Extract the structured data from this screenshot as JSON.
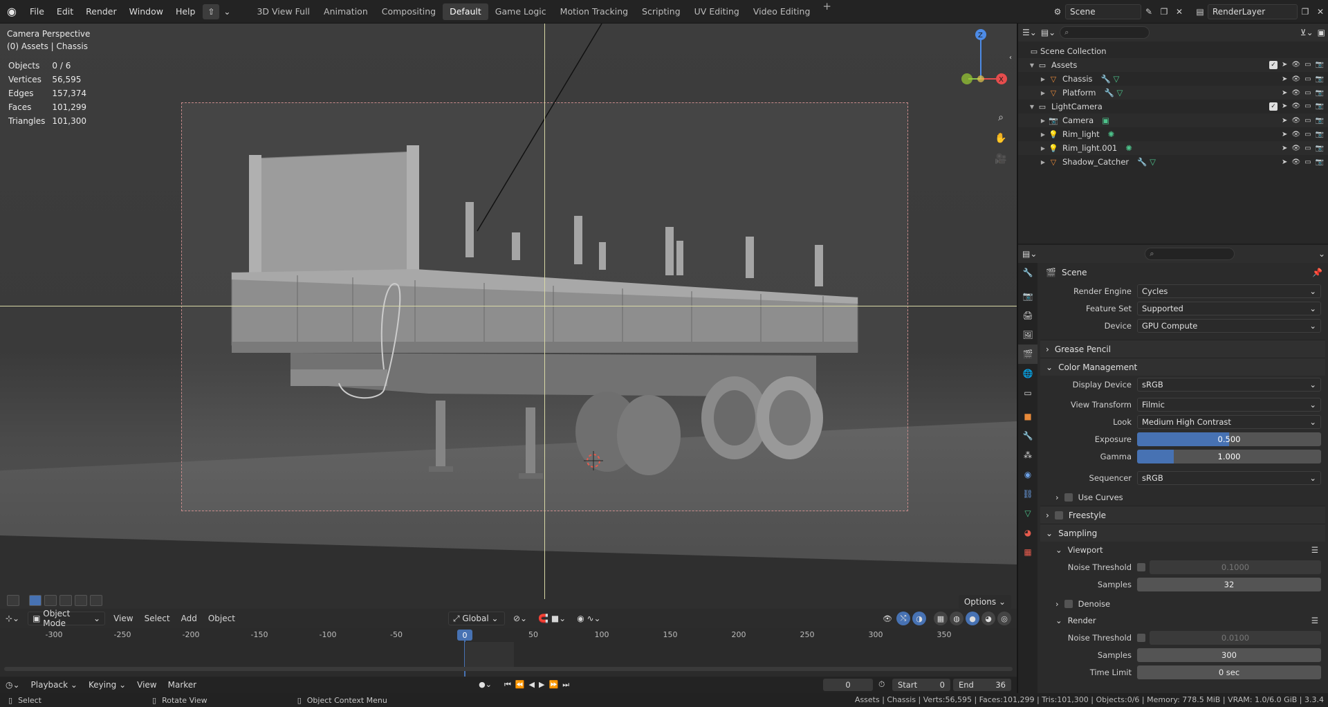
{
  "menu": [
    "File",
    "Edit",
    "Render",
    "Window",
    "Help"
  ],
  "workspaces": [
    "3D View Full",
    "Animation",
    "Compositing",
    "Default",
    "Game Logic",
    "Motion Tracking",
    "Scripting",
    "UV Editing",
    "Video Editing"
  ],
  "active_workspace": "Default",
  "scene_name": "Scene",
  "view_layer": "RenderLayer",
  "viewport": {
    "title": "Camera Perspective",
    "subtitle": "(0) Assets | Chassis",
    "stats": [
      {
        "label": "Objects",
        "value": "0 / 6"
      },
      {
        "label": "Vertices",
        "value": "56,595"
      },
      {
        "label": "Edges",
        "value": "157,374"
      },
      {
        "label": "Faces",
        "value": "101,299"
      },
      {
        "label": "Triangles",
        "value": "101,300"
      }
    ],
    "options_label": "Options"
  },
  "header": {
    "mode": "Object Mode",
    "menus": [
      "View",
      "Select",
      "Add",
      "Object"
    ],
    "transform": "Global"
  },
  "timeline": {
    "ticks": [
      "-300",
      "-250",
      "-200",
      "-150",
      "-100",
      "-50",
      "0",
      "50",
      "100",
      "150",
      "200",
      "250",
      "300",
      "350"
    ],
    "current_frame": "0",
    "menus": [
      "Playback",
      "Keying",
      "View",
      "Marker"
    ],
    "frame_field": "0",
    "start_label": "Start",
    "start": "0",
    "end_label": "End",
    "end": "36"
  },
  "status": {
    "select": "Select",
    "rotate": "Rotate View",
    "context": "Object Context Menu",
    "info": "Assets | Chassis | Verts:56,595 | Faces:101,299 | Tris:101,300 | Objects:0/6 | Memory: 778.5 MiB | VRAM: 1.0/6.0 GiB | 3.3.4"
  },
  "outliner": {
    "root": "Scene Collection",
    "items": [
      {
        "name": "Assets",
        "level": 1,
        "kind": "collection"
      },
      {
        "name": "Chassis",
        "level": 2,
        "kind": "mesh"
      },
      {
        "name": "Platform",
        "level": 2,
        "kind": "mesh"
      },
      {
        "name": "LightCamera",
        "level": 1,
        "kind": "collection"
      },
      {
        "name": "Camera",
        "level": 2,
        "kind": "camera"
      },
      {
        "name": "Rim_light",
        "level": 2,
        "kind": "light"
      },
      {
        "name": "Rim_light.001",
        "level": 2,
        "kind": "light"
      },
      {
        "name": "Shadow_Catcher",
        "level": 2,
        "kind": "mesh"
      }
    ]
  },
  "properties": {
    "context": "Scene",
    "render_engine_label": "Render Engine",
    "render_engine": "Cycles",
    "feature_set_label": "Feature Set",
    "feature_set": "Supported",
    "device_label": "Device",
    "device": "GPU Compute",
    "grease_pencil": "Grease Pencil",
    "color_management": "Color Management",
    "display_device_label": "Display Device",
    "display_device": "sRGB",
    "view_transform_label": "View Transform",
    "view_transform": "Filmic",
    "look_label": "Look",
    "look": "Medium High Contrast",
    "exposure_label": "Exposure",
    "exposure": "0.500",
    "exposure_fill": 0.5,
    "gamma_label": "Gamma",
    "gamma": "1.000",
    "gamma_fill": 0.2,
    "sequencer_label": "Sequencer",
    "sequencer": "sRGB",
    "use_curves": "Use Curves",
    "freestyle": "Freestyle",
    "sampling": "Sampling",
    "viewport_sec": "Viewport",
    "vp_noise_label": "Noise Threshold",
    "vp_noise": "0.1000",
    "vp_samples_label": "Samples",
    "vp_samples": "32",
    "denoise": "Denoise",
    "render_sec": "Render",
    "r_noise_label": "Noise Threshold",
    "r_noise": "0.0100",
    "r_samples_label": "Samples",
    "r_samples": "300",
    "time_limit_label": "Time Limit",
    "time_limit": "0 sec"
  },
  "colors": {
    "accent": "#4772b3",
    "bg": "#1d1d1d"
  }
}
